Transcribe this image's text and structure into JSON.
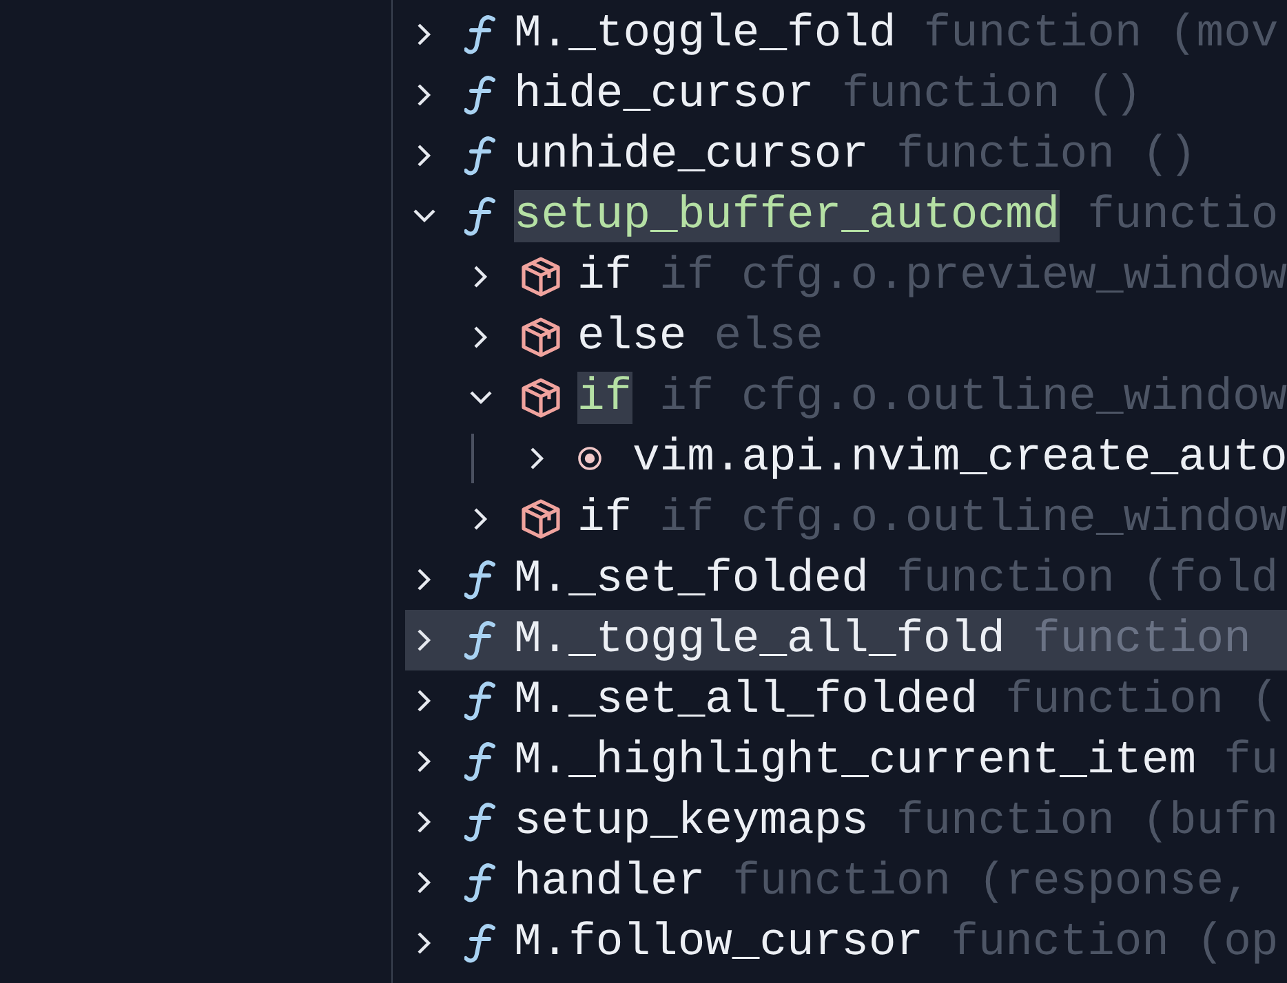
{
  "outline": {
    "items": [
      {
        "kind": "function",
        "name": "M._toggle_fold",
        "detail": "function (mov",
        "expanded": false,
        "highlighted": false,
        "selected": false
      },
      {
        "kind": "function",
        "name": "hide_cursor",
        "detail": "function ()",
        "expanded": false,
        "highlighted": false,
        "selected": false
      },
      {
        "kind": "function",
        "name": "unhide_cursor",
        "detail": "function ()",
        "expanded": false,
        "highlighted": false,
        "selected": false
      },
      {
        "kind": "function",
        "name": "setup_buffer_autocmd",
        "detail": "functio",
        "expanded": true,
        "highlighted": true,
        "selected": false,
        "children": [
          {
            "kind": "block",
            "name": "if",
            "detail": "if cfg.o.preview_window",
            "expanded": false,
            "highlighted": false,
            "selected": false
          },
          {
            "kind": "block",
            "name": "else",
            "detail": "else",
            "expanded": false,
            "highlighted": false,
            "selected": false
          },
          {
            "kind": "block",
            "name": "if",
            "detail": "if cfg.o.outline_window",
            "expanded": true,
            "highlighted": true,
            "selected": false,
            "children": [
              {
                "kind": "call",
                "name": "vim.api.nvim_create_auto",
                "expanded": false,
                "highlighted": false,
                "selected": false
              }
            ]
          },
          {
            "kind": "block",
            "name": "if",
            "detail": "if cfg.o.outline_window",
            "expanded": false,
            "highlighted": false,
            "selected": false
          }
        ]
      },
      {
        "kind": "function",
        "name": "M._set_folded",
        "detail": "function (fold",
        "expanded": false,
        "highlighted": false,
        "selected": false
      },
      {
        "kind": "function",
        "name": "M._toggle_all_fold",
        "detail": "function",
        "expanded": false,
        "highlighted": false,
        "selected": true
      },
      {
        "kind": "function",
        "name": "M._set_all_folded",
        "detail": "function (",
        "expanded": false,
        "highlighted": false,
        "selected": false
      },
      {
        "kind": "function",
        "name": "M._highlight_current_item",
        "detail": "fu",
        "expanded": false,
        "highlighted": false,
        "selected": false
      },
      {
        "kind": "function",
        "name": "setup_keymaps",
        "detail": "function (bufn",
        "expanded": false,
        "highlighted": false,
        "selected": false
      },
      {
        "kind": "function",
        "name": "handler",
        "detail": "function (response,",
        "expanded": false,
        "highlighted": false,
        "selected": false
      },
      {
        "kind": "function",
        "name": "M.follow_cursor",
        "detail": "function (op",
        "expanded": false,
        "highlighted": false,
        "selected": false
      }
    ]
  }
}
